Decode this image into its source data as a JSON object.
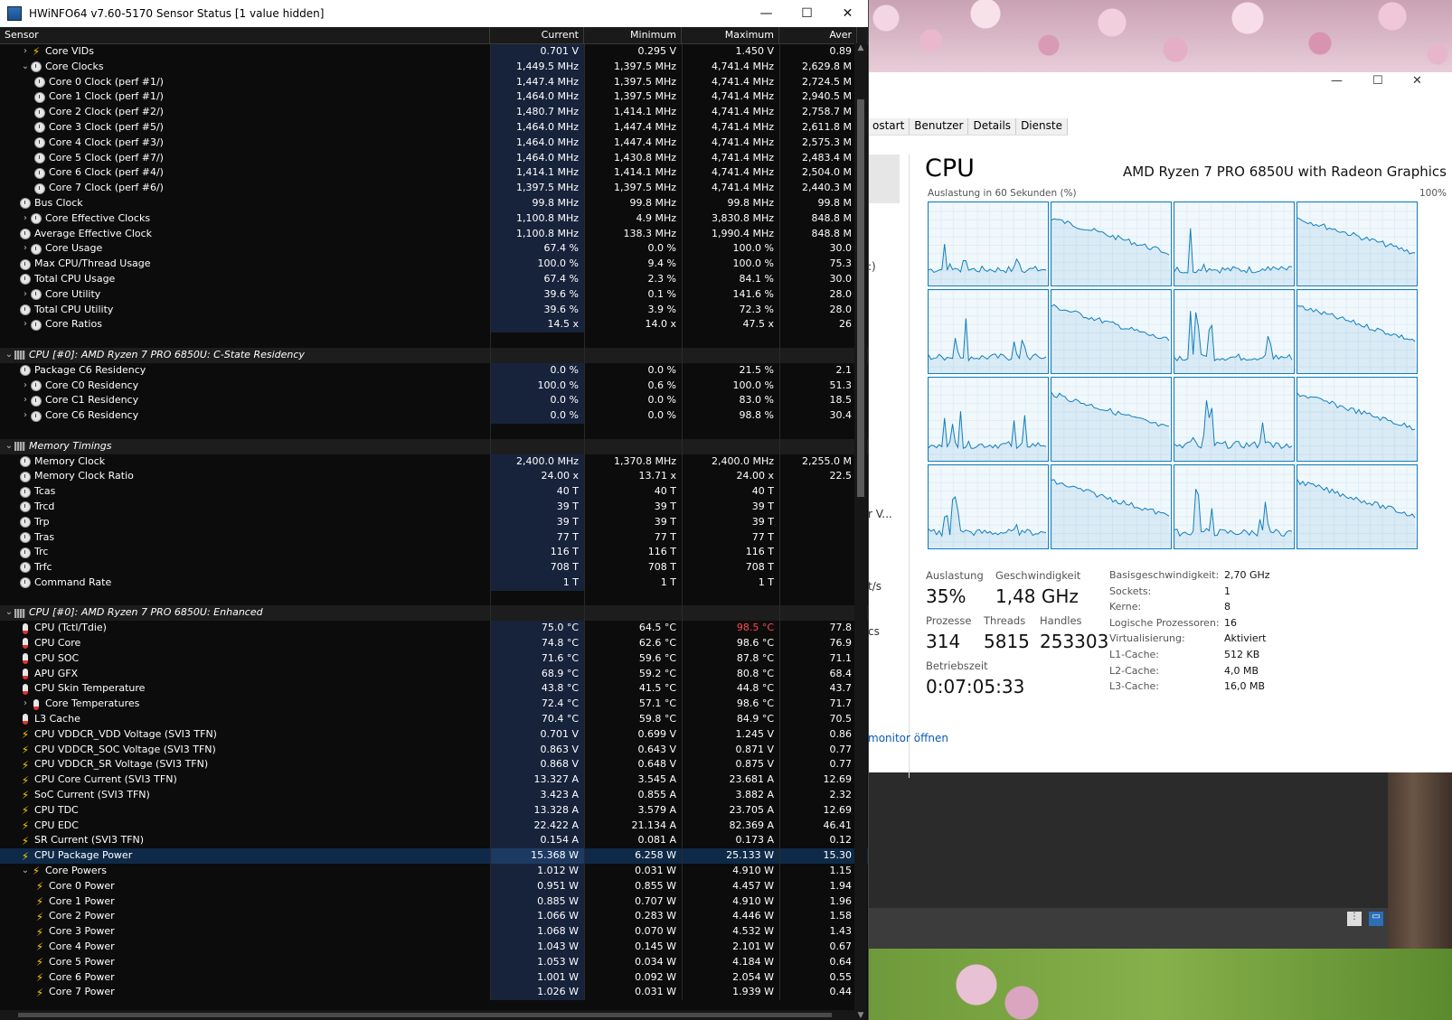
{
  "hwinfo": {
    "title": "HWiNFO64 v7.60-5170 Sensor Status [1 value hidden]",
    "columns": [
      "Sensor",
      "Current",
      "Minimum",
      "Maximum",
      "Aver"
    ],
    "rows": [
      {
        "indent": 1,
        "exp": ">",
        "icon": "bolt",
        "name": "Core VIDs",
        "cur": "0.701 V",
        "min": "0.295 V",
        "max": "1.450 V",
        "avg": "0.89"
      },
      {
        "indent": 1,
        "exp": "v",
        "icon": "clock",
        "name": "Core Clocks",
        "cur": "1,449.5 MHz",
        "min": "1,397.5 MHz",
        "max": "4,741.4 MHz",
        "avg": "2,629.8 M"
      },
      {
        "indent": 2,
        "exp": "",
        "icon": "clock",
        "name": "Core 0 Clock (perf #1/)",
        "cur": "1,447.4 MHz",
        "min": "1,397.5 MHz",
        "max": "4,741.4 MHz",
        "avg": "2,724.5 M"
      },
      {
        "indent": 2,
        "exp": "",
        "icon": "clock",
        "name": "Core 1 Clock (perf #1/)",
        "cur": "1,464.0 MHz",
        "min": "1,397.5 MHz",
        "max": "4,741.4 MHz",
        "avg": "2,940.5 M"
      },
      {
        "indent": 2,
        "exp": "",
        "icon": "clock",
        "name": "Core 2 Clock (perf #2/)",
        "cur": "1,480.7 MHz",
        "min": "1,414.1 MHz",
        "max": "4,741.4 MHz",
        "avg": "2,758.7 M"
      },
      {
        "indent": 2,
        "exp": "",
        "icon": "clock",
        "name": "Core 3 Clock (perf #5/)",
        "cur": "1,464.0 MHz",
        "min": "1,447.4 MHz",
        "max": "4,741.4 MHz",
        "avg": "2,611.8 M"
      },
      {
        "indent": 2,
        "exp": "",
        "icon": "clock",
        "name": "Core 4 Clock (perf #3/)",
        "cur": "1,464.0 MHz",
        "min": "1,447.4 MHz",
        "max": "4,741.4 MHz",
        "avg": "2,575.3 M"
      },
      {
        "indent": 2,
        "exp": "",
        "icon": "clock",
        "name": "Core 5 Clock (perf #7/)",
        "cur": "1,464.0 MHz",
        "min": "1,430.8 MHz",
        "max": "4,741.4 MHz",
        "avg": "2,483.4 M"
      },
      {
        "indent": 2,
        "exp": "",
        "icon": "clock",
        "name": "Core 6 Clock (perf #4/)",
        "cur": "1,414.1 MHz",
        "min": "1,414.1 MHz",
        "max": "4,741.4 MHz",
        "avg": "2,504.0 M"
      },
      {
        "indent": 2,
        "exp": "",
        "icon": "clock",
        "name": "Core 7 Clock (perf #6/)",
        "cur": "1,397.5 MHz",
        "min": "1,397.5 MHz",
        "max": "4,741.4 MHz",
        "avg": "2,440.3 M"
      },
      {
        "indent": 0,
        "exp": "",
        "icon": "clock",
        "name": "Bus Clock",
        "cur": "99.8 MHz",
        "min": "99.8 MHz",
        "max": "99.8 MHz",
        "avg": "99.8 M"
      },
      {
        "indent": 1,
        "exp": ">",
        "icon": "clock",
        "name": "Core Effective Clocks",
        "cur": "1,100.8 MHz",
        "min": "4.9 MHz",
        "max": "3,830.8 MHz",
        "avg": "848.8 M"
      },
      {
        "indent": 0,
        "exp": "",
        "icon": "clock",
        "name": "Average Effective Clock",
        "cur": "1,100.8 MHz",
        "min": "138.3 MHz",
        "max": "1,990.4 MHz",
        "avg": "848.8 M"
      },
      {
        "indent": 1,
        "exp": ">",
        "icon": "clock",
        "name": "Core Usage",
        "cur": "67.4 %",
        "min": "0.0 %",
        "max": "100.0 %",
        "avg": "30.0"
      },
      {
        "indent": 0,
        "exp": "",
        "icon": "clock",
        "name": "Max CPU/Thread Usage",
        "cur": "100.0 %",
        "min": "9.4 %",
        "max": "100.0 %",
        "avg": "75.3"
      },
      {
        "indent": 0,
        "exp": "",
        "icon": "clock",
        "name": "Total CPU Usage",
        "cur": "67.4 %",
        "min": "2.3 %",
        "max": "84.1 %",
        "avg": "30.0"
      },
      {
        "indent": 1,
        "exp": ">",
        "icon": "clock",
        "name": "Core Utility",
        "cur": "39.6 %",
        "min": "0.1 %",
        "max": "141.6 %",
        "avg": "28.0"
      },
      {
        "indent": 0,
        "exp": "",
        "icon": "clock",
        "name": "Total CPU Utility",
        "cur": "39.6 %",
        "min": "3.9 %",
        "max": "72.3 %",
        "avg": "28.0"
      },
      {
        "indent": 1,
        "exp": ">",
        "icon": "clock",
        "name": "Core Ratios",
        "cur": "14.5 x",
        "min": "14.0 x",
        "max": "47.5 x",
        "avg": "26"
      },
      {
        "blank": true
      },
      {
        "group": true,
        "name": "CPU [#0]: AMD Ryzen 7 PRO 6850U: C-State Residency"
      },
      {
        "indent": 0,
        "exp": "",
        "icon": "clock",
        "name": "Package C6 Residency",
        "cur": "0.0 %",
        "min": "0.0 %",
        "max": "21.5 %",
        "avg": "2.1"
      },
      {
        "indent": 1,
        "exp": ">",
        "icon": "clock",
        "name": "Core C0 Residency",
        "cur": "100.0 %",
        "min": "0.6 %",
        "max": "100.0 %",
        "avg": "51.3"
      },
      {
        "indent": 1,
        "exp": ">",
        "icon": "clock",
        "name": "Core C1 Residency",
        "cur": "0.0 %",
        "min": "0.0 %",
        "max": "83.0 %",
        "avg": "18.5"
      },
      {
        "indent": 1,
        "exp": ">",
        "icon": "clock",
        "name": "Core C6 Residency",
        "cur": "0.0 %",
        "min": "0.0 %",
        "max": "98.8 %",
        "avg": "30.4"
      },
      {
        "blank": true
      },
      {
        "group": true,
        "name": "Memory Timings"
      },
      {
        "indent": 0,
        "exp": "",
        "icon": "clock",
        "name": "Memory Clock",
        "cur": "2,400.0 MHz",
        "min": "1,370.8 MHz",
        "max": "2,400.0 MHz",
        "avg": "2,255.0 M"
      },
      {
        "indent": 0,
        "exp": "",
        "icon": "clock",
        "name": "Memory Clock Ratio",
        "cur": "24.00 x",
        "min": "13.71 x",
        "max": "24.00 x",
        "avg": "22.5"
      },
      {
        "indent": 0,
        "exp": "",
        "icon": "clock",
        "name": "Tcas",
        "cur": "40 T",
        "min": "40 T",
        "max": "40 T",
        "avg": ""
      },
      {
        "indent": 0,
        "exp": "",
        "icon": "clock",
        "name": "Trcd",
        "cur": "39 T",
        "min": "39 T",
        "max": "39 T",
        "avg": ""
      },
      {
        "indent": 0,
        "exp": "",
        "icon": "clock",
        "name": "Trp",
        "cur": "39 T",
        "min": "39 T",
        "max": "39 T",
        "avg": ""
      },
      {
        "indent": 0,
        "exp": "",
        "icon": "clock",
        "name": "Tras",
        "cur": "77 T",
        "min": "77 T",
        "max": "77 T",
        "avg": ""
      },
      {
        "indent": 0,
        "exp": "",
        "icon": "clock",
        "name": "Trc",
        "cur": "116 T",
        "min": "116 T",
        "max": "116 T",
        "avg": ""
      },
      {
        "indent": 0,
        "exp": "",
        "icon": "clock",
        "name": "Trfc",
        "cur": "708 T",
        "min": "708 T",
        "max": "708 T",
        "avg": ""
      },
      {
        "indent": 0,
        "exp": "",
        "icon": "clock",
        "name": "Command Rate",
        "cur": "1 T",
        "min": "1 T",
        "max": "1 T",
        "avg": ""
      },
      {
        "blank": true
      },
      {
        "group": true,
        "name": "CPU [#0]: AMD Ryzen 7 PRO 6850U: Enhanced"
      },
      {
        "indent": 0,
        "exp": "",
        "icon": "therm",
        "name": "CPU (Tctl/Tdie)",
        "cur": "75.0 °C",
        "min": "64.5 °C",
        "max": "98.5 °C",
        "avg": "77.8",
        "maxRed": true
      },
      {
        "indent": 0,
        "exp": "",
        "icon": "therm",
        "name": "CPU Core",
        "cur": "74.8 °C",
        "min": "62.6 °C",
        "max": "98.6 °C",
        "avg": "76.9"
      },
      {
        "indent": 0,
        "exp": "",
        "icon": "therm",
        "name": "CPU SOC",
        "cur": "71.6 °C",
        "min": "59.6 °C",
        "max": "87.8 °C",
        "avg": "71.1"
      },
      {
        "indent": 0,
        "exp": "",
        "icon": "therm",
        "name": "APU GFX",
        "cur": "68.9 °C",
        "min": "59.2 °C",
        "max": "80.8 °C",
        "avg": "68.4"
      },
      {
        "indent": 0,
        "exp": "",
        "icon": "therm",
        "name": "CPU Skin Temperature",
        "cur": "43.8 °C",
        "min": "41.5 °C",
        "max": "44.8 °C",
        "avg": "43.7"
      },
      {
        "indent": 1,
        "exp": ">",
        "icon": "therm",
        "name": "Core Temperatures",
        "cur": "72.4 °C",
        "min": "57.1 °C",
        "max": "98.6 °C",
        "avg": "71.7"
      },
      {
        "indent": 0,
        "exp": "",
        "icon": "therm",
        "name": "L3 Cache",
        "cur": "70.4 °C",
        "min": "59.8 °C",
        "max": "84.9 °C",
        "avg": "70.5"
      },
      {
        "indent": 0,
        "exp": "",
        "icon": "bolt",
        "name": "CPU VDDCR_VDD Voltage (SVI3 TFN)",
        "cur": "0.701 V",
        "min": "0.699 V",
        "max": "1.245 V",
        "avg": "0.86"
      },
      {
        "indent": 0,
        "exp": "",
        "icon": "bolt",
        "name": "CPU VDDCR_SOC Voltage (SVI3 TFN)",
        "cur": "0.863 V",
        "min": "0.643 V",
        "max": "0.871 V",
        "avg": "0.77"
      },
      {
        "indent": 0,
        "exp": "",
        "icon": "bolt",
        "name": "CPU VDDCR_SR Voltage (SVI3 TFN)",
        "cur": "0.868 V",
        "min": "0.648 V",
        "max": "0.875 V",
        "avg": "0.77"
      },
      {
        "indent": 0,
        "exp": "",
        "icon": "bolt",
        "name": "CPU Core Current (SVI3 TFN)",
        "cur": "13.327 A",
        "min": "3.545 A",
        "max": "23.681 A",
        "avg": "12.69"
      },
      {
        "indent": 0,
        "exp": "",
        "icon": "bolt",
        "name": "SoC Current (SVI3 TFN)",
        "cur": "3.423 A",
        "min": "0.855 A",
        "max": "3.882 A",
        "avg": "2.32"
      },
      {
        "indent": 0,
        "exp": "",
        "icon": "bolt",
        "name": "CPU TDC",
        "cur": "13.328 A",
        "min": "3.579 A",
        "max": "23.705 A",
        "avg": "12.69"
      },
      {
        "indent": 0,
        "exp": "",
        "icon": "bolt",
        "name": "CPU EDC",
        "cur": "22.422 A",
        "min": "21.134 A",
        "max": "82.369 A",
        "avg": "46.41"
      },
      {
        "indent": 0,
        "exp": "",
        "icon": "bolt",
        "name": "SR Current (SVI3 TFN)",
        "cur": "0.154 A",
        "min": "0.081 A",
        "max": "0.173 A",
        "avg": "0.12"
      },
      {
        "indent": 0,
        "exp": "",
        "icon": "bolt",
        "name": "CPU Package Power",
        "cur": "15.368 W",
        "min": "6.258 W",
        "max": "25.133 W",
        "avg": "15.30",
        "selected": true
      },
      {
        "indent": 1,
        "exp": "v",
        "icon": "bolt",
        "name": "Core Powers",
        "cur": "1.012 W",
        "min": "0.031 W",
        "max": "4.910 W",
        "avg": "1.15"
      },
      {
        "indent": 2,
        "exp": "",
        "icon": "bolt",
        "name": "Core 0 Power",
        "cur": "0.951 W",
        "min": "0.855 W",
        "max": "4.457 W",
        "avg": "1.94"
      },
      {
        "indent": 2,
        "exp": "",
        "icon": "bolt",
        "name": "Core 1 Power",
        "cur": "0.885 W",
        "min": "0.707 W",
        "max": "4.910 W",
        "avg": "1.96"
      },
      {
        "indent": 2,
        "exp": "",
        "icon": "bolt",
        "name": "Core 2 Power",
        "cur": "1.066 W",
        "min": "0.283 W",
        "max": "4.446 W",
        "avg": "1.58"
      },
      {
        "indent": 2,
        "exp": "",
        "icon": "bolt",
        "name": "Core 3 Power",
        "cur": "1.068 W",
        "min": "0.070 W",
        "max": "4.532 W",
        "avg": "1.43"
      },
      {
        "indent": 2,
        "exp": "",
        "icon": "bolt",
        "name": "Core 4 Power",
        "cur": "1.043 W",
        "min": "0.145 W",
        "max": "2.101 W",
        "avg": "0.67"
      },
      {
        "indent": 2,
        "exp": "",
        "icon": "bolt",
        "name": "Core 5 Power",
        "cur": "1.053 W",
        "min": "0.034 W",
        "max": "4.184 W",
        "avg": "0.64"
      },
      {
        "indent": 2,
        "exp": "",
        "icon": "bolt",
        "name": "Core 6 Power",
        "cur": "1.001 W",
        "min": "0.092 W",
        "max": "2.054 W",
        "avg": "0.55"
      },
      {
        "indent": 2,
        "exp": "",
        "icon": "bolt",
        "name": "Core 7 Power",
        "cur": "1.026 W",
        "min": "0.031 W",
        "max": "1.939 W",
        "avg": "0.44"
      }
    ],
    "colors": {
      "max_alert": "#ff4a4a",
      "current_bg": "#17233b",
      "selected_bg": "#0f2a48"
    }
  },
  "taskmgr": {
    "tabs": [
      "ostart",
      "Benutzer",
      "Details",
      "Dienste"
    ],
    "left_stubs": [
      ":)",
      "r V...",
      "t/s",
      "cs"
    ],
    "cpu_title": "CPU",
    "cpu_name": "AMD Ryzen 7 PRO 6850U with Radeon Graphics",
    "util_label": "Auslastung in 60 Sekunden (%)",
    "util_max": "100%",
    "stats": {
      "auslastung_label": "Auslastung",
      "auslastung": "35%",
      "geschw_label": "Geschwindigkeit",
      "geschw": "1,48 GHz",
      "prozesse_label": "Prozesse",
      "prozesse": "314",
      "threads_label": "Threads",
      "threads": "5815",
      "handles_label": "Handles",
      "handles": "253303",
      "betrieb_label": "Betriebszeit",
      "betrieb": "0:07:05:33"
    },
    "specs": [
      {
        "k": "Basisgeschwindigkeit:",
        "v": "2,70 GHz"
      },
      {
        "k": "Sockets:",
        "v": "1"
      },
      {
        "k": "Kerne:",
        "v": "8"
      },
      {
        "k": "Logische Prozessoren:",
        "v": "16"
      },
      {
        "k": "Virtualisierung:",
        "v": "Aktiviert"
      },
      {
        "k": "L1-Cache:",
        "v": "512 KB"
      },
      {
        "k": "L2-Cache:",
        "v": "4,0 MB"
      },
      {
        "k": "L3-Cache:",
        "v": "16,0 MB"
      }
    ],
    "link": "monitor öffnen",
    "graph_color": "#117dbb"
  }
}
